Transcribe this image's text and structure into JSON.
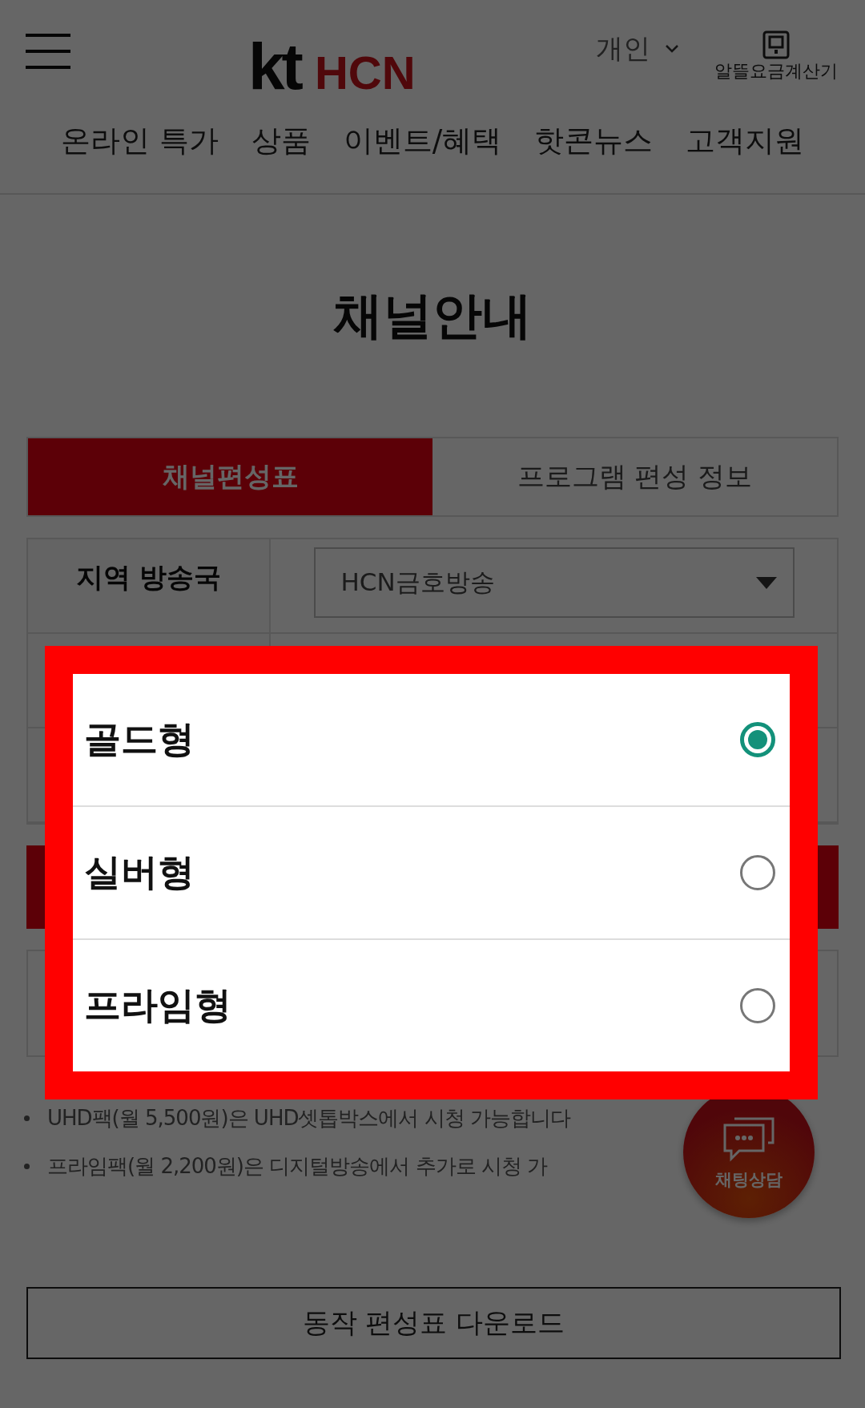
{
  "header": {
    "logo": {
      "brand": "kt",
      "name": "HCN"
    },
    "segment": "개인",
    "calculator": "알뜰요금계산기"
  },
  "nav": [
    "온라인 특가",
    "상품",
    "이벤트/혜택",
    "핫콘뉴스",
    "고객지원"
  ],
  "page_title": "채널안내",
  "tabs": [
    {
      "label": "채널편성표",
      "selected": true
    },
    {
      "label": "프로그램 편성 정보",
      "selected": false
    }
  ],
  "form": {
    "region_label": "지역 방송국",
    "region_value": "HCN금호방송"
  },
  "notes": [
    "UHD팩(월 5,500원)은 UHD셋톱박스에서 시청 가능합니다",
    "프라임팩(월 2,200원)은 디지털방송에서 추가로 시청 가"
  ],
  "chat_button": "채팅상담",
  "download_button": "동작 편성표 다운로드",
  "picker": {
    "options": [
      {
        "label": "골드형",
        "selected": true
      },
      {
        "label": "실버형",
        "selected": false
      },
      {
        "label": "프라임형",
        "selected": false
      }
    ]
  }
}
